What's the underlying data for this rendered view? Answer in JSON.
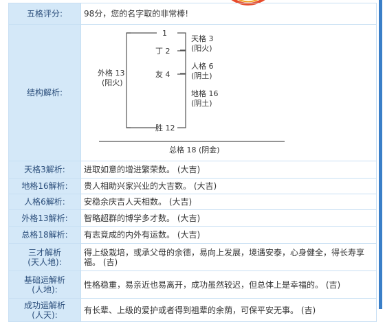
{
  "table": {
    "score": {
      "label": "五格评分:",
      "value": "98分，您的名字取的非常棒!"
    },
    "structure": {
      "label": "结构解析:",
      "diagram": {
        "left_col": [
          "1",
          "丁 2",
          "友 4",
          "胜 12"
        ],
        "outer": {
          "line1": "外格 13",
          "line2": "(阳火)"
        },
        "right": [
          {
            "line1": "天格 3",
            "line2": "(阳火)"
          },
          {
            "line1": "人格 6",
            "line2": "(阴土)"
          },
          {
            "line1": "地格 16",
            "line2": "(阴土)"
          }
        ],
        "total": "总格 18 (阴金)"
      }
    },
    "rows": [
      {
        "label": "天格3解析:",
        "value": "进取如意的增进繁荣数。 (大吉)"
      },
      {
        "label": "地格16解析:",
        "value": "贵人相助兴家兴业的大吉数。 (大吉)"
      },
      {
        "label": "人格6解析:",
        "value": "安稳余庆吉人天相数。 (大吉)"
      },
      {
        "label": "外格13解析:",
        "value": "智略超群的博学多才数。 (大吉)"
      },
      {
        "label": "总格18解析:",
        "value": "有志竟成的内外有运数。 (大吉)"
      },
      {
        "label": "三才解析\n(天人地):",
        "value": "得上级栽培，或承父母的余德，易向上发展，境遇安泰，心身健全，得长寿享福。 (吉)"
      },
      {
        "label": "基础运解析\n(人地):",
        "value": "性格稳重，易亲近也易离开，成功虽然较迟，但总体上是幸福的。 (吉)"
      },
      {
        "label": "成功运解析\n(人天):",
        "value": "有长辈、上级的爱护或者得到祖辈的余荫，可保平安无事。 (吉)"
      }
    ]
  },
  "colors": {
    "label_bg": "#d4e8f8",
    "border": "#c7dff3",
    "score_red": "#e60000",
    "side_bar": "#3a7fc8"
  }
}
